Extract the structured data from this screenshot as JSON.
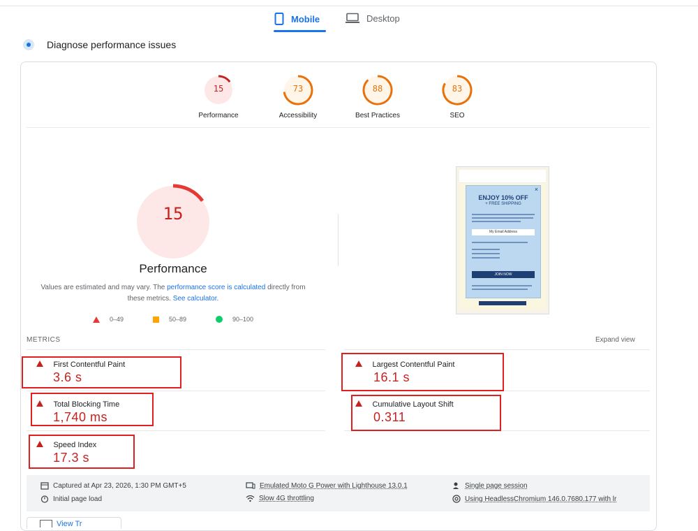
{
  "tabs": {
    "mobile": "Mobile",
    "desktop": "Desktop"
  },
  "diagnose_title": "Diagnose performance issues",
  "scores": [
    {
      "label": "Performance",
      "value": "15",
      "fraction": 0.15,
      "color": "#c5221f",
      "bg": "#fde8e7"
    },
    {
      "label": "Accessibility",
      "value": "73",
      "fraction": 0.73,
      "color": "#e8710a",
      "bg": "#fff5e8"
    },
    {
      "label": "Best Practices",
      "value": "88",
      "fraction": 0.88,
      "color": "#e8710a",
      "bg": "#fff5e8"
    },
    {
      "label": "SEO",
      "value": "83",
      "fraction": 0.83,
      "color": "#e8710a",
      "bg": "#fff5e8"
    }
  ],
  "main_score": {
    "value": "15",
    "label": "Performance",
    "fraction": 0.15
  },
  "note": {
    "text1": "Values are estimated and may vary. The ",
    "link1": "performance score is calculated",
    "text2": " directly from these metrics. ",
    "link2": "See calculator."
  },
  "legend": {
    "red": "0–49",
    "orange": "50–89",
    "green": "90–100"
  },
  "metrics_header": "METRICS",
  "expand_view": "Expand view",
  "metrics": {
    "fcp": {
      "name": "First Contentful Paint",
      "value": "3.6 s"
    },
    "lcp": {
      "name": "Largest Contentful Paint",
      "value": "16.1 s"
    },
    "tbt": {
      "name": "Total Blocking Time",
      "value": "1,740 ms"
    },
    "cls": {
      "name": "Cumulative Layout Shift",
      "value": "0.311"
    },
    "si": {
      "name": "Speed Index",
      "value": "17.3 s"
    }
  },
  "footer": {
    "captured": "Captured at Apr 23, 2026, 1:30 PM GMT+5",
    "initial_load": "Initial page load",
    "device": "Emulated Moto G Power with Lighthouse 13.0.1",
    "throttling": "Slow 4G throttling",
    "session": "Single page session",
    "browser": "Using HeadlessChromium 146.0.7680.177 with lr"
  },
  "screenshot": {
    "headline": "ENJOY 10% OFF",
    "sub": "+ FREE SHIPPING",
    "email_placeholder": "My Email Address",
    "join": "JOIN NOW",
    "close": "×"
  },
  "view_button": "View Tr"
}
